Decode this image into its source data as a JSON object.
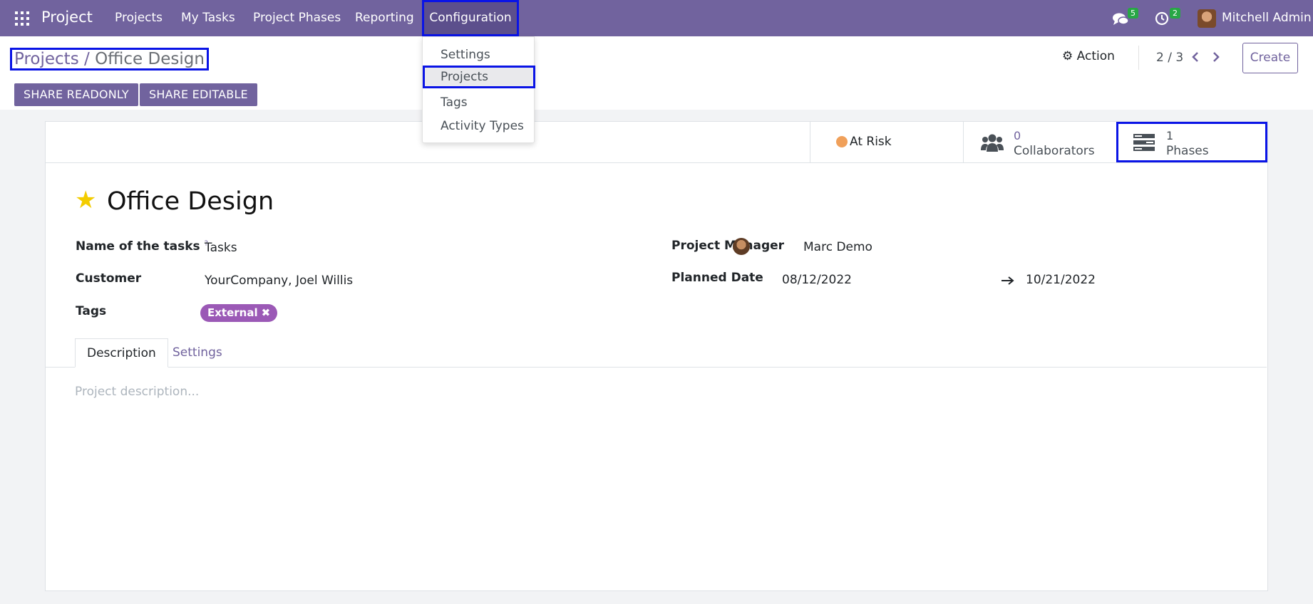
{
  "navbar": {
    "brand": "Project",
    "menus": [
      "Projects",
      "My Tasks",
      "Project Phases",
      "Reporting",
      "Configuration"
    ],
    "messages_count": "5",
    "activities_count": "2",
    "user_name": "Mitchell Admin"
  },
  "config_menu": {
    "items": [
      "Settings",
      "Projects",
      "Tags",
      "Activity Types"
    ]
  },
  "breadcrumb": {
    "parent": "Projects",
    "separator": "/",
    "current": "Office Design"
  },
  "control_panel": {
    "action_label": "Action",
    "pager": "2 / 3",
    "create_label": "Create",
    "share_readonly": "SHARE READONLY",
    "share_editable": "SHARE EDITABLE"
  },
  "stat_buttons": {
    "status": "At Risk",
    "collaborators_value": "0",
    "collaborators_label": "Collaborators",
    "phases_value": "1",
    "phases_label": "Phases"
  },
  "form": {
    "title": "Office Design",
    "task_name_label": "Name of the tasks",
    "task_name_help": "?",
    "task_name_value": "Tasks",
    "customer_label": "Customer",
    "customer_value": "YourCompany, Joel Willis",
    "tags_label": "Tags",
    "tag_value": "External",
    "manager_label": "Project Manager",
    "manager_value": "Marc Demo",
    "planned_label": "Planned Date",
    "planned_start": "08/12/2022",
    "planned_end": "10/21/2022"
  },
  "tabs": [
    "Description",
    "Settings"
  ],
  "description_placeholder": "Project description...",
  "colors": {
    "primary": "#71639e",
    "highlight": "#0a14e6",
    "badge": "#28a745",
    "tag": "#9b59b6",
    "status_at_risk": "#f0a05a",
    "star": "#f3cc00"
  }
}
